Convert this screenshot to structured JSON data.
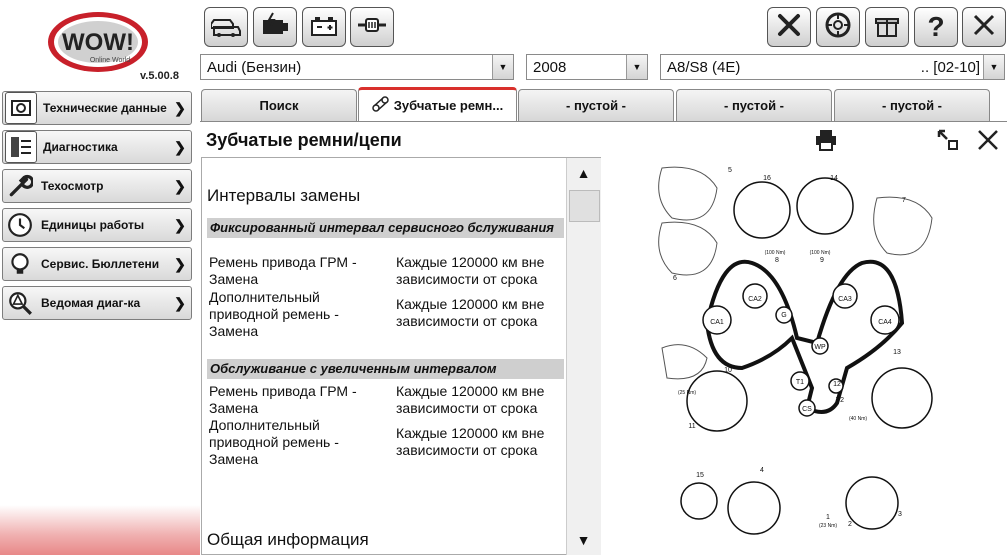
{
  "app": {
    "logo_text": "WOW!",
    "logo_sub": "Online World",
    "version": "v.5.00.8"
  },
  "sidebar": {
    "items": [
      {
        "label": "Технические данные",
        "icon": "engine-data-icon"
      },
      {
        "label": "Диагностика",
        "icon": "diagnostics-icon"
      },
      {
        "label": "Техосмотр",
        "icon": "wrench-icon"
      },
      {
        "label": "Единицы работы",
        "icon": "clock-icon"
      },
      {
        "label": "Сервис. Бюллетени",
        "icon": "bulb-icon"
      },
      {
        "label": "Ведомая диаг-ка",
        "icon": "magnifier-warning-icon"
      }
    ]
  },
  "toolbar": {
    "left": [
      "cars-icon",
      "engine-icon",
      "battery-icon",
      "connector-icon"
    ],
    "right": [
      "tools-icon",
      "support-icon",
      "gift-icon",
      "help-icon",
      "close-icon"
    ]
  },
  "selectors": {
    "make": "Audi (Бензин)",
    "year": "2008",
    "model": "A8/S8 (4E)",
    "model_range": ".. [02-10]"
  },
  "tabs": [
    {
      "label": "Поиск",
      "active": false
    },
    {
      "label": "Зубчатые ремн...",
      "active": true
    },
    {
      "label": "- пустой -",
      "active": false
    },
    {
      "label": "- пустой -",
      "active": false
    },
    {
      "label": "- пустой -",
      "active": false
    }
  ],
  "content": {
    "title": "Зубчатые ремни/цепи",
    "section1": "Интервалы замены",
    "group1": {
      "header": "Фиксированный интервал сервисного бслуживания",
      "rows": [
        {
          "item": "Ремень привода ГРМ - Замена",
          "interval": "Каждые 120000 км вне зависимости от срока"
        },
        {
          "item": "Дополнительный приводной ремень - Замена",
          "interval": "Каждые 120000 км вне зависимости от срока"
        }
      ]
    },
    "group2": {
      "header": "Обслуживание с увеличенным интервалом",
      "rows": [
        {
          "item": "Ремень привода ГРМ - Замена",
          "interval": "Каждые 120000 км вне зависимости от срока"
        },
        {
          "item": "Дополнительный приводной ремень - Замена",
          "interval": "Каждые 120000 км вне зависимости от срока"
        }
      ]
    },
    "section2": "Общая информация"
  },
  "diagram": {
    "labels": [
      "5",
      "16",
      "14",
      "7",
      "6",
      "8",
      "9",
      "CA2",
      "CA3",
      "G",
      "CA1",
      "CA4",
      "WP",
      "10",
      "13",
      "T1",
      "T2",
      "CS",
      "11",
      "15",
      "12",
      "4",
      "3",
      "2",
      "1"
    ],
    "torques": [
      "(100 Nm)",
      "(100 Nm)",
      "(25 Nm)",
      "(40 Nm)",
      "(23 Nm)"
    ]
  },
  "colors": {
    "active_tab_accent": "#d9302c",
    "logo_red": "#c8202a"
  }
}
